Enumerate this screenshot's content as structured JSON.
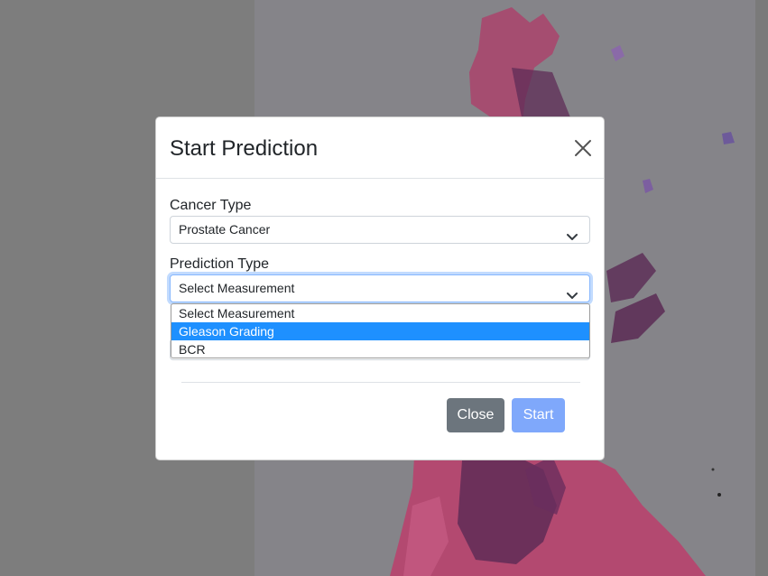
{
  "modal": {
    "title": "Start Prediction",
    "close_icon": "close-icon",
    "cancer_type": {
      "label": "Cancer Type",
      "selected": "Prostate Cancer"
    },
    "prediction_type": {
      "label": "Prediction Type",
      "selected": "Select Measurement",
      "options": [
        "Select Measurement",
        "Gleason Grading",
        "BCR"
      ],
      "highlighted_option": "Gleason Grading"
    },
    "buttons": {
      "close_label": "Close",
      "start_label": "Start"
    }
  },
  "colors": {
    "overlay": "#7d7d7d",
    "primary": "#0d6efd",
    "primary_disabled": "#7fa8fb",
    "secondary": "#6c757d",
    "option_highlight": "#1e90ff",
    "tissue_pink": "#b8436e",
    "tissue_purple": "#5a2a55"
  }
}
